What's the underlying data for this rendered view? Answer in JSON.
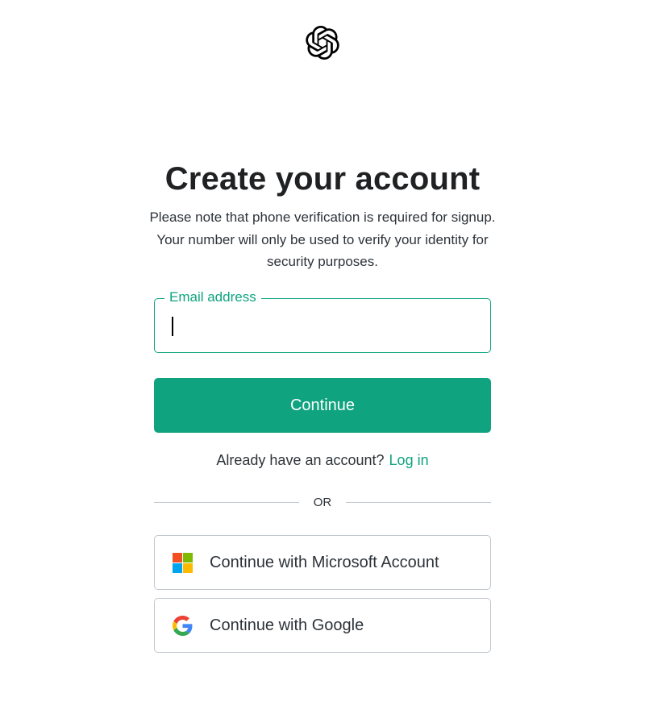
{
  "logo": {
    "icon": "openai-logo-icon"
  },
  "heading": {
    "title": "Create your account",
    "subtitle": "Please note that phone verification is required for signup. Your number will only be used to verify your identity for security purposes."
  },
  "email": {
    "label": "Email address",
    "value": ""
  },
  "continue_button": {
    "label": "Continue"
  },
  "login": {
    "prompt": "Already have an account?",
    "link_label": "Log in"
  },
  "divider": {
    "label": "OR"
  },
  "social": {
    "microsoft": {
      "label": "Continue with Microsoft Account",
      "icon": "microsoft-logo-icon"
    },
    "google": {
      "label": "Continue with Google",
      "icon": "google-logo-icon"
    }
  },
  "colors": {
    "accent": "#10a37f",
    "border": "#c2c8d0",
    "text": "#2d333a",
    "microsoft_red": "#f25022",
    "microsoft_green": "#7fba00",
    "microsoft_blue": "#00a4ef",
    "microsoft_yellow": "#ffb900"
  }
}
